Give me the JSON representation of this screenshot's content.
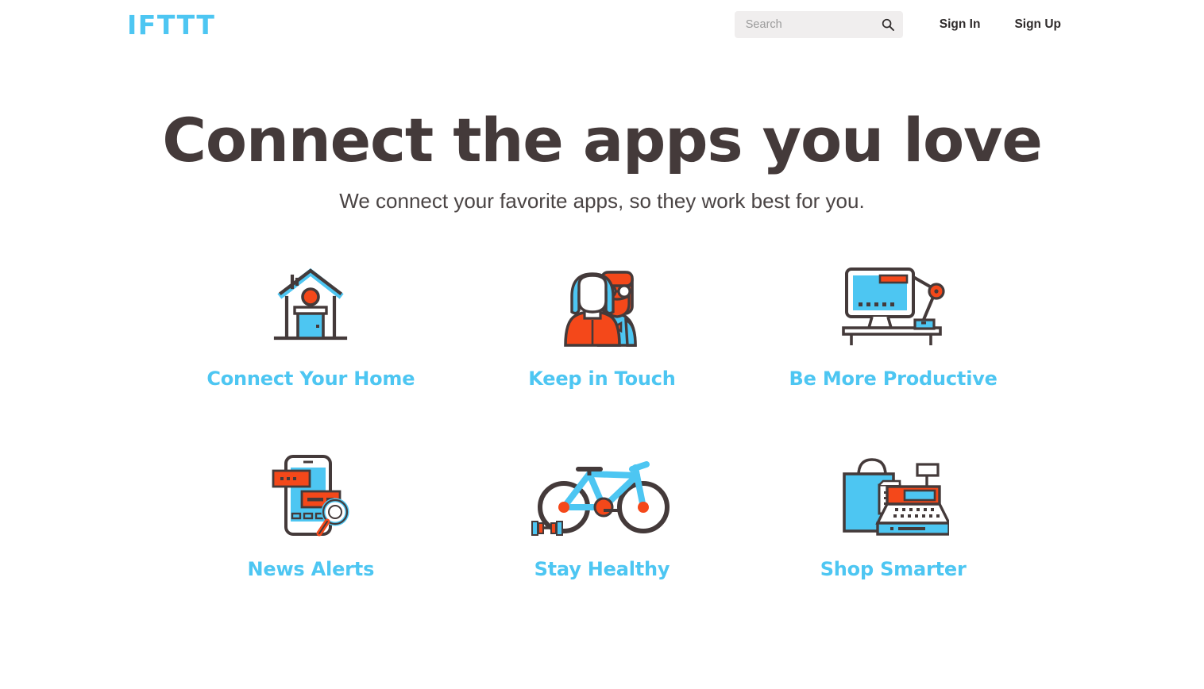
{
  "header": {
    "logo": "IFTTT",
    "search": {
      "placeholder": "Search",
      "value": "",
      "icon": "search-icon"
    },
    "sign_in": "Sign In",
    "sign_up": "Sign Up"
  },
  "hero": {
    "title": "Connect the apps you love",
    "subtitle": "We connect your favorite apps, so they work best for you."
  },
  "categories": [
    {
      "label": "Connect Your Home",
      "icon": "house-icon"
    },
    {
      "label": "Keep in Touch",
      "icon": "people-icon"
    },
    {
      "label": "Be More Productive",
      "icon": "desktop-computer-icon"
    },
    {
      "label": "News Alerts",
      "icon": "phone-notifications-icon"
    },
    {
      "label": "Stay Healthy",
      "icon": "bicycle-icon"
    },
    {
      "label": "Shop Smarter",
      "icon": "shopping-bag-cash-register-icon"
    }
  ],
  "colors": {
    "brand_blue": "#4DC6F2",
    "accent_orange": "#F4481A",
    "dark_brown": "#443a3a",
    "page_background": "#FFFFFF",
    "search_background": "#F0EEEE"
  }
}
